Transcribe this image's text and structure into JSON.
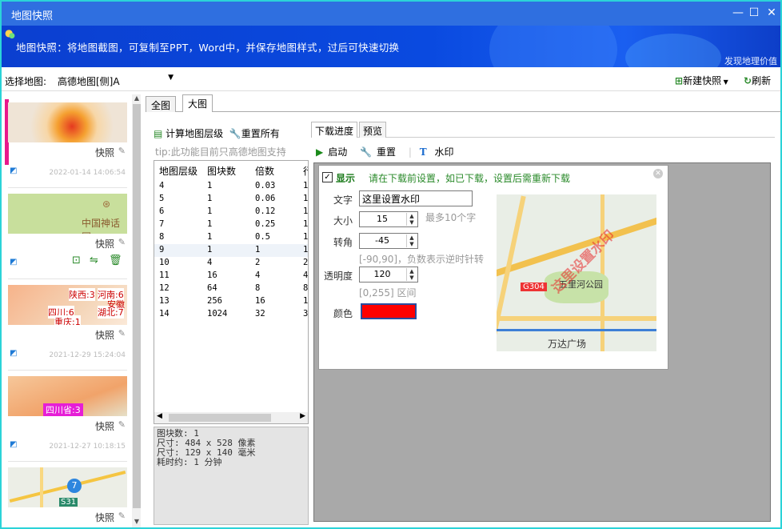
{
  "window": {
    "title": "地图快照"
  },
  "banner": {
    "message": "地图快照：将地图截图，可复制至PPT，Word中，并保存地图样式，过后可快速切换",
    "tagline": "发现地理价值"
  },
  "toolbar": {
    "select_label": "选择地图:",
    "select_value": "高德地图[侧]A",
    "new_snapshot": "新建快照",
    "refresh": "刷新"
  },
  "snapshots": [
    {
      "name": "快照",
      "date": "2022-01-14 14:06:54"
    },
    {
      "name": "快照",
      "date": "",
      "map_label": "中国神话园"
    },
    {
      "name": "快照",
      "date": "2021-12-29 15:24:04",
      "map_labels": [
        "陕西:3",
        "河南:6",
        "四川:6",
        "湖北:7",
        "重庆:1",
        "安徽"
      ]
    },
    {
      "name": "快照",
      "date": "2021-12-27 10:18:15",
      "map_label": "四川省:3"
    },
    {
      "name": "快照",
      "date": "",
      "map_label": "S31",
      "marker": "7"
    }
  ],
  "tabs": [
    "全图",
    "大图"
  ],
  "left": {
    "calc": "计算地图层级",
    "reset_all": "重置所有",
    "tip": "tip:此功能目前只高德地图支持",
    "columns": [
      "地图层级",
      "图块数",
      "倍数",
      "行"
    ],
    "rows": [
      [
        "4",
        "1",
        "0.03",
        "1"
      ],
      [
        "5",
        "1",
        "0.06",
        "1"
      ],
      [
        "6",
        "1",
        "0.12",
        "1"
      ],
      [
        "7",
        "1",
        "0.25",
        "1"
      ],
      [
        "8",
        "1",
        "0.5",
        "1"
      ],
      [
        "9",
        "1",
        "1",
        "1"
      ],
      [
        "10",
        "4",
        "2",
        "2"
      ],
      [
        "11",
        "16",
        "4",
        "4"
      ],
      [
        "12",
        "64",
        "8",
        "8"
      ],
      [
        "13",
        "256",
        "16",
        "1"
      ],
      [
        "14",
        "1024",
        "32",
        "3"
      ]
    ],
    "info": [
      "图块数: 1",
      "尺寸: 484 x 528 像素",
      "尺寸: 129 x 140 毫米",
      "耗时约: 1 分钟"
    ]
  },
  "right": {
    "tabs": [
      "下载进度",
      "预览"
    ],
    "start": "启动",
    "reset": "重置",
    "watermark": "水印",
    "dialog": {
      "show": "显示",
      "notice": "请在下载前设置，如已下载，设置后需重新下载",
      "text_label": "文字",
      "text_value": "这里设置水印",
      "size_label": "大小",
      "size_value": "15",
      "size_hint": "最多10个字",
      "angle_label": "转角",
      "angle_value": "-45",
      "angle_hint": "[-90,90]，负数表示逆时针转",
      "opacity_label": "透明度",
      "opacity_value": "120",
      "opacity_hint": "[0,255] 区间",
      "color_label": "颜色",
      "color_value": "#ff0000",
      "preview_watermark": "这里设置水印",
      "preview_labels": [
        "G304",
        "五里河公园",
        "万达广场"
      ]
    }
  }
}
